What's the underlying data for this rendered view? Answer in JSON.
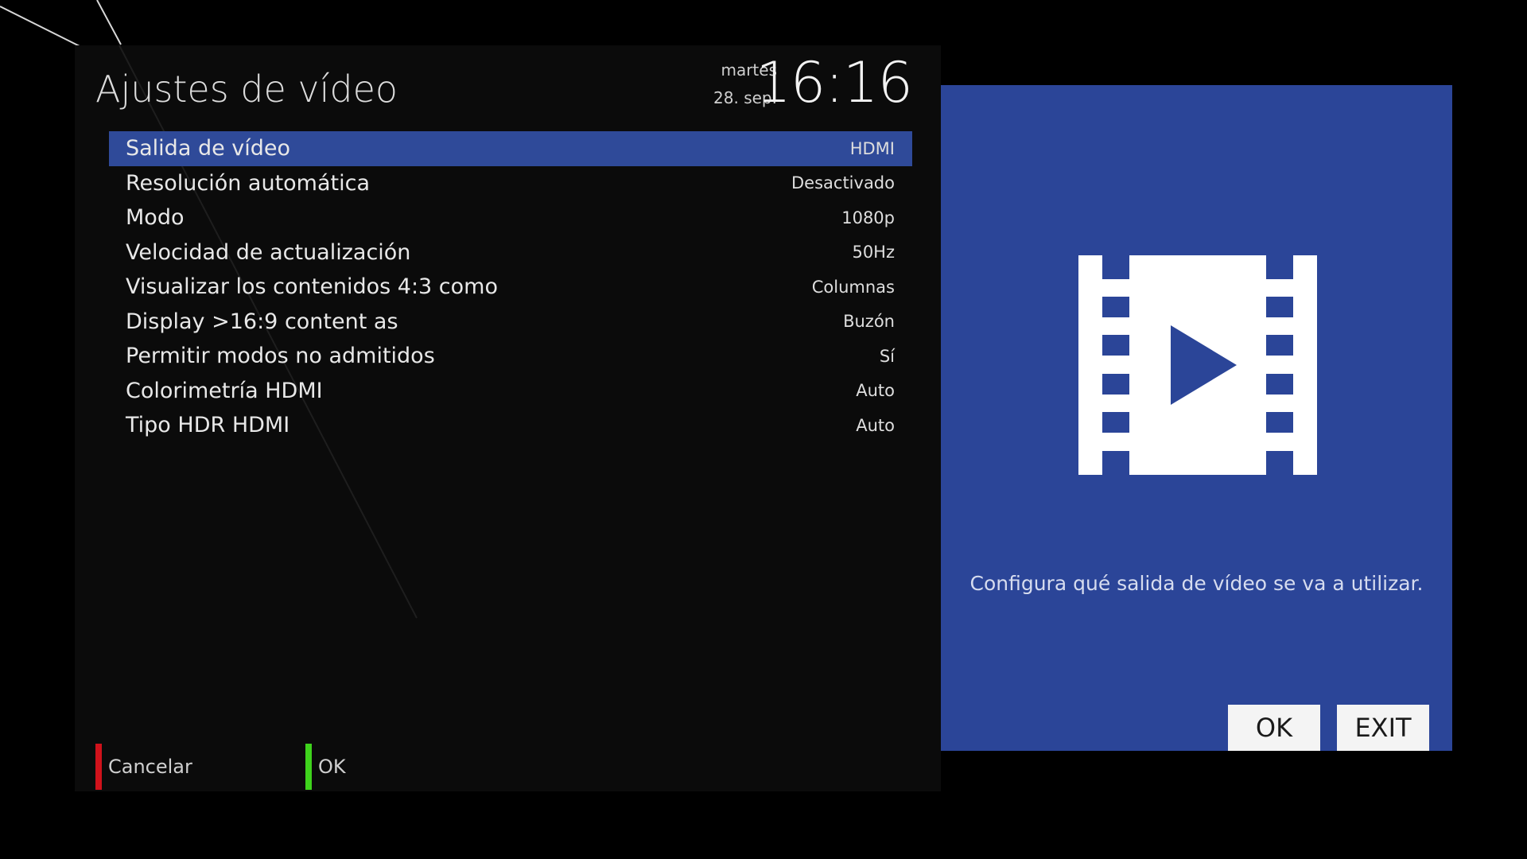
{
  "screen": {
    "title": "Ajustes de vídeo",
    "day": "martes",
    "date": "28. sep.",
    "time": "16:16"
  },
  "menu": {
    "items": [
      {
        "label": "Salida de vídeo",
        "value": "HDMI",
        "selected": true
      },
      {
        "label": "Resolución automática",
        "value": "Desactivado"
      },
      {
        "label": "Modo",
        "value": "1080p"
      },
      {
        "label": "Velocidad de actualización",
        "value": "50Hz"
      },
      {
        "label": "Visualizar los contenidos 4:3 como",
        "value": "Columnas"
      },
      {
        "label": "Display >16:9 content as",
        "value": "Buzón"
      },
      {
        "label": "Permitir modos no admitidos",
        "value": "Sí"
      },
      {
        "label": "Colorimetría HDMI",
        "value": "Auto"
      },
      {
        "label": "Tipo HDR HDMI",
        "value": "Auto"
      }
    ]
  },
  "footer": {
    "cancel_label": "Cancelar",
    "ok_label": "OK",
    "red_color": "#d0121b",
    "green_color": "#3ed31c"
  },
  "info": {
    "icon": "film-play-icon",
    "description": "Configura qué salida de vídeo se va a utilizar.",
    "ok_button": "OK",
    "exit_button": "EXIT",
    "accent_color": "#2b4598"
  }
}
